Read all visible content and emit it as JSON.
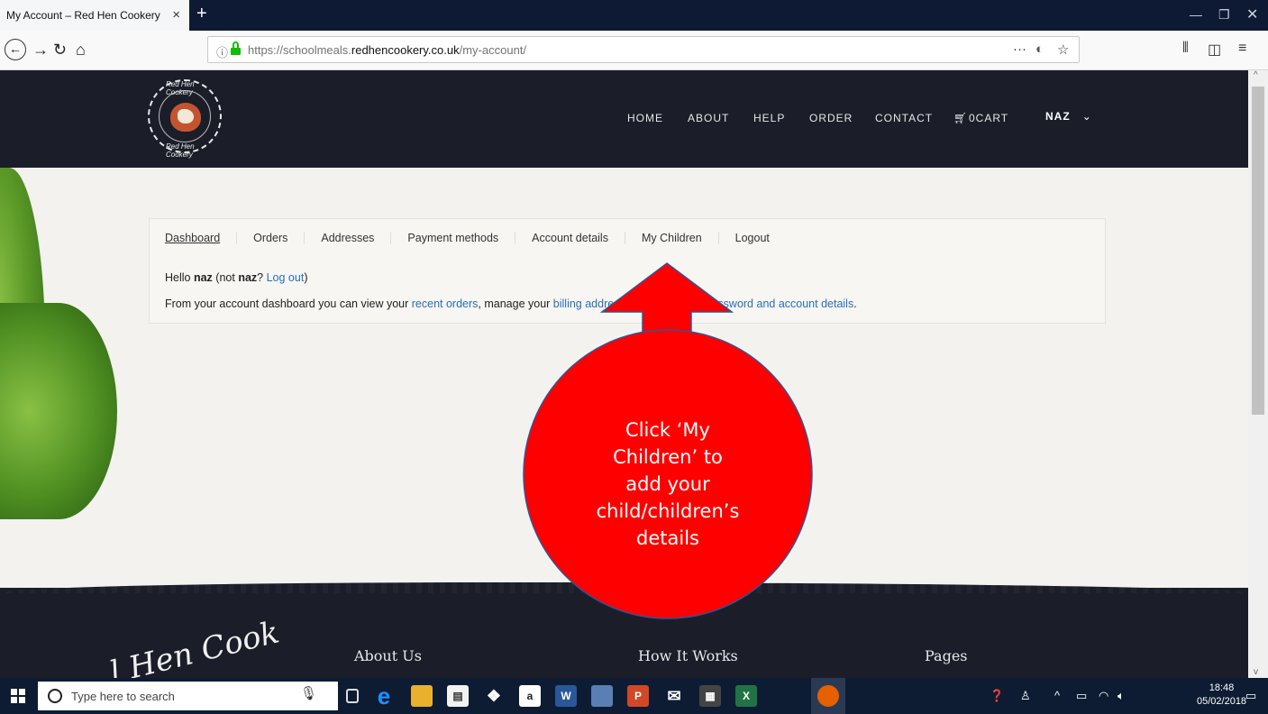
{
  "browser": {
    "tab_title": "My Account – Red Hen Cookery",
    "tab_close": "×",
    "new_tab": "+",
    "url_prefix": "https://schoolmeals.",
    "url_domain": "redhencookery.co.uk",
    "url_path": "/my-account/",
    "page_actions": "···"
  },
  "site": {
    "logo_top": "Red Hen Cookery",
    "logo_bottom": "Red Hen Cookery",
    "nav": [
      "HOME",
      "ABOUT",
      "HELP",
      "ORDER",
      "CONTACT"
    ],
    "cart": "0CART",
    "user": "NAZ",
    "user_chevron": "⌄"
  },
  "account": {
    "tabs": [
      "Dashboard",
      "Orders",
      "Addresses",
      "Payment methods",
      "Account details",
      "My Children",
      "Logout"
    ],
    "hello_prefix": "Hello ",
    "hello_name": "naz",
    "hello_mid": " (not ",
    "hello_name2": "naz",
    "hello_q": "? ",
    "logout_link": "Log out",
    "hello_end": ")",
    "intro_1": "From your account dashboard you can view your ",
    "intro_link_orders": "recent orders",
    "intro_2": ", manage your ",
    "intro_link_billing": "billing addres",
    "intro_link_password": "assword and account details",
    "intro_end": "."
  },
  "footer": {
    "logo_text": "Hen Cook",
    "logo_left": "l",
    "about": "About Us",
    "how": "How It Works",
    "pages": "Pages"
  },
  "annotation": {
    "lines": [
      "Click ‘My",
      "Children’ to",
      "add your",
      "child/children’s",
      "details"
    ],
    "fill": "#ff0000",
    "stroke": "#2f5597"
  },
  "taskbar": {
    "search_placeholder": "Type here to search",
    "time": "18:48",
    "date": "05/02/2018"
  }
}
